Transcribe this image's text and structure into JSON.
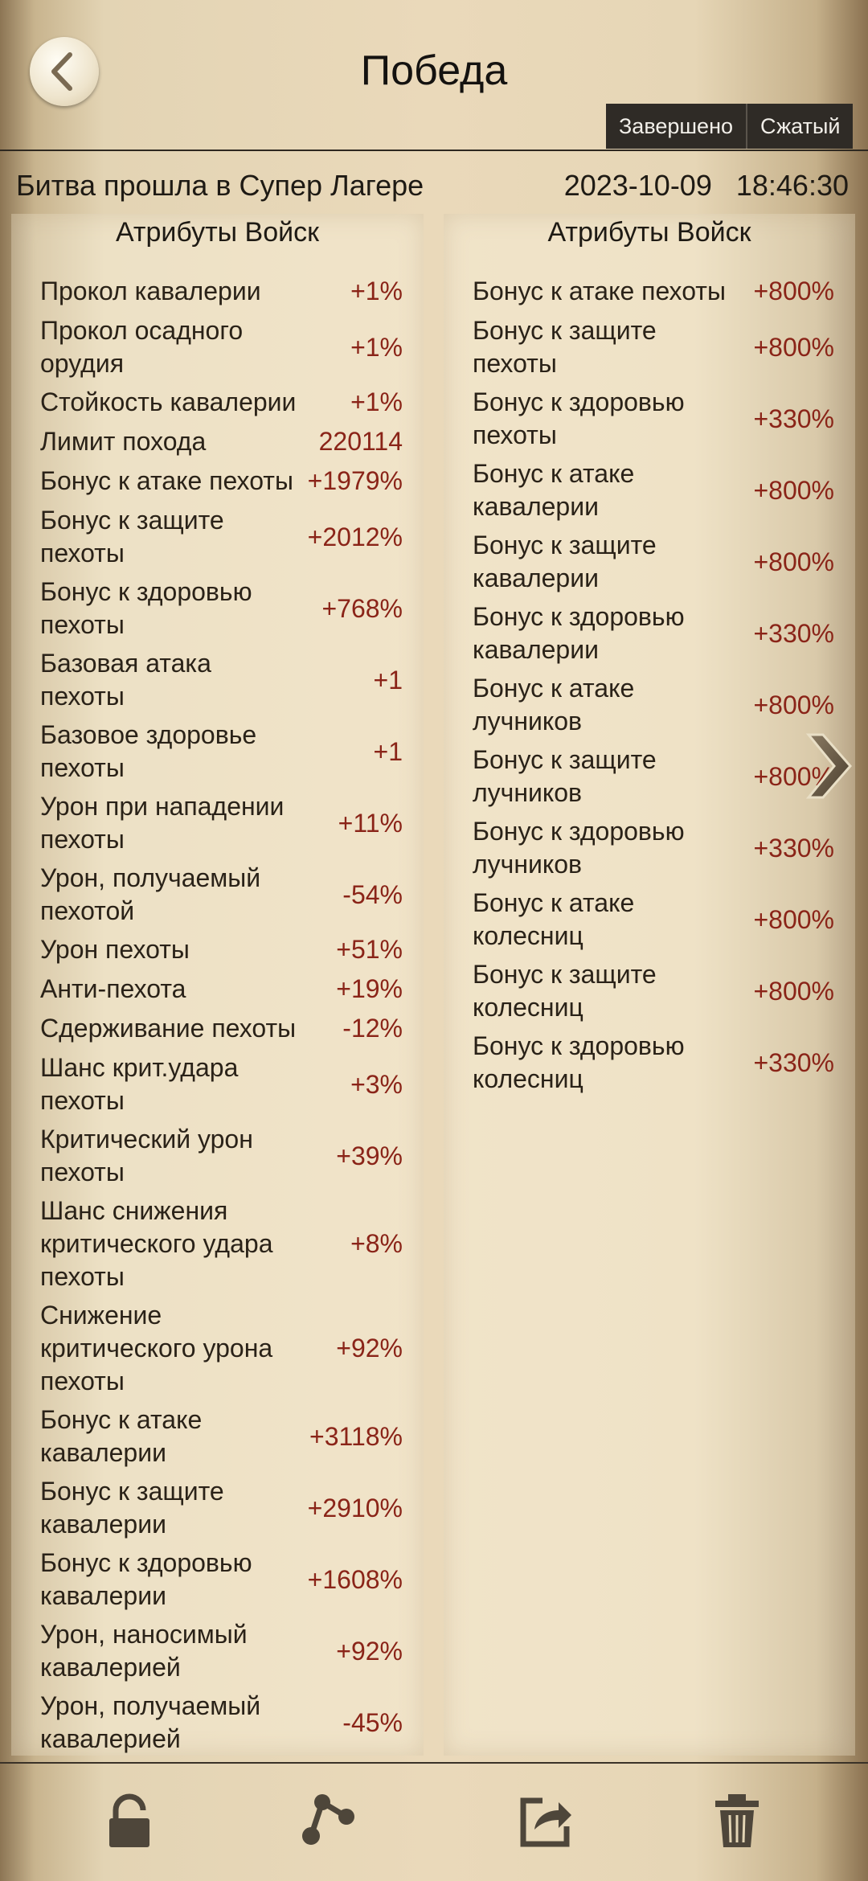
{
  "header": {
    "title": "Победа",
    "segment_done": "Завершено",
    "segment_compact": "Сжатый"
  },
  "info": {
    "location": "Битва прошла в Супер Лагере",
    "datetime": "2023-10-09   18:46:30"
  },
  "left": {
    "heading": "Атрибуты Войск",
    "rows": [
      {
        "label": "Прокол кавалерии",
        "value": "+1%"
      },
      {
        "label": "Прокол осадного\nорудия",
        "value": "+1%"
      },
      {
        "label": "Стойкость кавалерии",
        "value": "+1%"
      },
      {
        "label": "Лимит похода",
        "value": "220114"
      },
      {
        "label": "Бонус к атаке пехоты",
        "value": "+1979%"
      },
      {
        "label": "Бонус к защите\nпехоты",
        "value": "+2012%"
      },
      {
        "label": "Бонус к здоровью\nпехоты",
        "value": "+768%"
      },
      {
        "label": "Базовая атака\nпехоты",
        "value": "+1"
      },
      {
        "label": "Базовое здоровье\nпехоты",
        "value": "+1"
      },
      {
        "label": "Урон при нападении\nпехоты",
        "value": "+11%"
      },
      {
        "label": "Урон, получаемый\nпехотой",
        "value": "-54%"
      },
      {
        "label": "Урон пехоты",
        "value": "+51%"
      },
      {
        "label": "Анти-пехота",
        "value": "+19%"
      },
      {
        "label": "Сдерживание пехоты",
        "value": "-12%"
      },
      {
        "label": "Шанс крит.удара\nпехоты",
        "value": "+3%"
      },
      {
        "label": "Критический урон\nпехоты",
        "value": "+39%"
      },
      {
        "label": "Шанс снижения\nкритического удара\nпехоты",
        "value": "+8%"
      },
      {
        "label": "Снижение\nкритического урона\nпехоты",
        "value": "+92%"
      },
      {
        "label": "Бонус к атаке\nкавалерии",
        "value": "+3118%"
      },
      {
        "label": "Бонус к защите\nкавалерии",
        "value": "+2910%"
      },
      {
        "label": "Бонус к здоровью\nкавалерии",
        "value": "+1608%"
      },
      {
        "label": "Урон, наносимый\nкавалерией",
        "value": "+92%"
      },
      {
        "label": "Урон, получаемый\nкавалерией",
        "value": "-45%"
      }
    ]
  },
  "right": {
    "heading": "Атрибуты Войск",
    "rows": [
      {
        "label": "Бонус к атаке пехоты",
        "value": "+800%"
      },
      {
        "label": "Бонус к защите\nпехоты",
        "value": "+800%"
      },
      {
        "label": "Бонус к здоровью\nпехоты",
        "value": "+330%"
      },
      {
        "label": "Бонус к атаке\nкавалерии",
        "value": "+800%"
      },
      {
        "label": "Бонус к защите\nкавалерии",
        "value": "+800%"
      },
      {
        "label": "Бонус к здоровью\nкавалерии",
        "value": "+330%"
      },
      {
        "label": "Бонус к атаке\nлучников",
        "value": "+800%"
      },
      {
        "label": "Бонус к защите\nлучников",
        "value": "+800%"
      },
      {
        "label": "Бонус к здоровью\nлучников",
        "value": "+330%"
      },
      {
        "label": "Бонус к атаке\nколесниц",
        "value": "+800%"
      },
      {
        "label": "Бонус к защите\nколесниц",
        "value": "+800%"
      },
      {
        "label": "Бонус к здоровью\nколесниц",
        "value": "+330%"
      }
    ]
  },
  "icons": {
    "back": "chevron-left-icon",
    "next": "chevron-right-icon",
    "lock": "lock-icon",
    "share": "share-icon",
    "export": "export-icon",
    "delete": "trash-icon"
  },
  "colors": {
    "value_red": "#8a2418",
    "toolbar_bg": "#2f2b26"
  }
}
